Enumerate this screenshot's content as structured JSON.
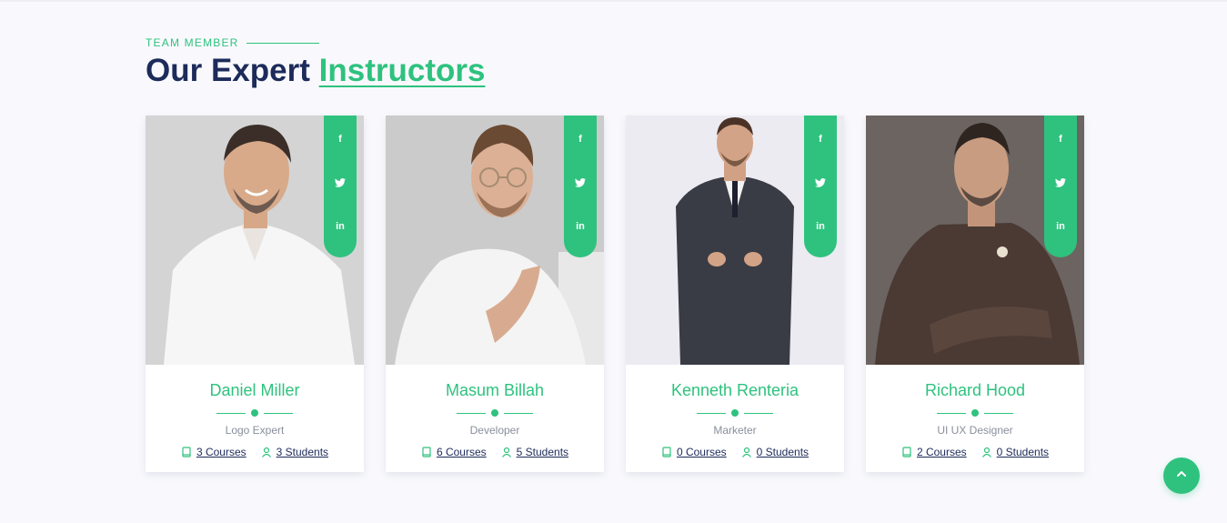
{
  "section": {
    "eyebrow": "TEAM MEMBER",
    "title_main": "Our Expert",
    "title_accent": "Instructors"
  },
  "colors": {
    "accent": "#2ec27e",
    "heading": "#1c2b5a",
    "muted": "#8a8f9c",
    "background": "#f9f9fd"
  },
  "social_icons": [
    "facebook-icon",
    "twitter-icon",
    "linkedin-icon"
  ],
  "instructors": [
    {
      "name": "Daniel Miller",
      "role": "Logo Expert",
      "courses": "3 Courses",
      "students": "3 Students"
    },
    {
      "name": "Masum Billah",
      "role": "Developer",
      "courses": "6 Courses",
      "students": "5 Students"
    },
    {
      "name": "Kenneth Renteria",
      "role": "Marketer",
      "courses": "0 Courses",
      "students": "0 Students"
    },
    {
      "name": "Richard Hood",
      "role": "UI UX Designer",
      "courses": "2 Courses",
      "students": "0 Students"
    }
  ],
  "back_to_top_icon": "chevron-up-icon"
}
